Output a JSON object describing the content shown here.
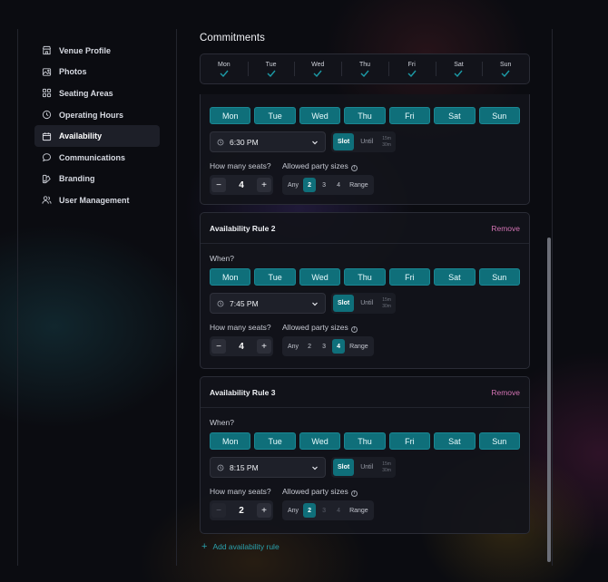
{
  "sidebar": {
    "items": [
      {
        "label": "Venue Profile",
        "icon": "storefront-icon",
        "active": false
      },
      {
        "label": "Photos",
        "icon": "image-icon",
        "active": false
      },
      {
        "label": "Seating Areas",
        "icon": "grid-icon",
        "active": false
      },
      {
        "label": "Operating Hours",
        "icon": "clock-icon",
        "active": false
      },
      {
        "label": "Availability",
        "icon": "calendar-icon",
        "active": true
      },
      {
        "label": "Communications",
        "icon": "chat-bubble-icon",
        "active": false
      },
      {
        "label": "Branding",
        "icon": "branding-icon",
        "active": false
      },
      {
        "label": "User Management",
        "icon": "users-icon",
        "active": false
      }
    ]
  },
  "commitments": {
    "title": "Commitments",
    "days": [
      "Mon",
      "Tue",
      "Wed",
      "Thu",
      "Fri",
      "Sat",
      "Sun"
    ]
  },
  "rules": [
    {
      "title": "",
      "remove_label": "",
      "when_label": "",
      "days": [
        "Mon",
        "Tue",
        "Wed",
        "Thu",
        "Fri",
        "Sat",
        "Sun"
      ],
      "time": "6:30 PM",
      "mode_slot": "Slot",
      "mode_until": "Until",
      "mode_15": "15m",
      "mode_30": "30m",
      "seats_label": "How many seats?",
      "party_label": "Allowed party sizes",
      "seats": "4",
      "party_options": [
        "Any",
        "2",
        "3",
        "4",
        "Range"
      ],
      "party_selected": "2"
    },
    {
      "title": "Availability Rule 2",
      "remove_label": "Remove",
      "when_label": "When?",
      "days": [
        "Mon",
        "Tue",
        "Wed",
        "Thu",
        "Fri",
        "Sat",
        "Sun"
      ],
      "time": "7:45 PM",
      "mode_slot": "Slot",
      "mode_until": "Until",
      "mode_15": "15m",
      "mode_30": "30m",
      "seats_label": "How many seats?",
      "party_label": "Allowed party sizes",
      "seats": "4",
      "party_options": [
        "Any",
        "2",
        "3",
        "4",
        "Range"
      ],
      "party_selected": "4"
    },
    {
      "title": "Availability Rule 3",
      "remove_label": "Remove",
      "when_label": "When?",
      "days": [
        "Mon",
        "Tue",
        "Wed",
        "Thu",
        "Fri",
        "Sat",
        "Sun"
      ],
      "time": "8:15 PM",
      "mode_slot": "Slot",
      "mode_until": "Until",
      "mode_15": "15m",
      "mode_30": "30m",
      "seats_label": "How many seats?",
      "party_label": "Allowed party sizes",
      "seats": "2",
      "party_options": [
        "Any",
        "2",
        "3",
        "4",
        "Range"
      ],
      "party_selected": "2"
    }
  ],
  "add_rule_label": "Add availability rule",
  "colors": {
    "accent": "#0f6f7a",
    "remove": "#d273b3",
    "link": "#2aa1ad"
  }
}
